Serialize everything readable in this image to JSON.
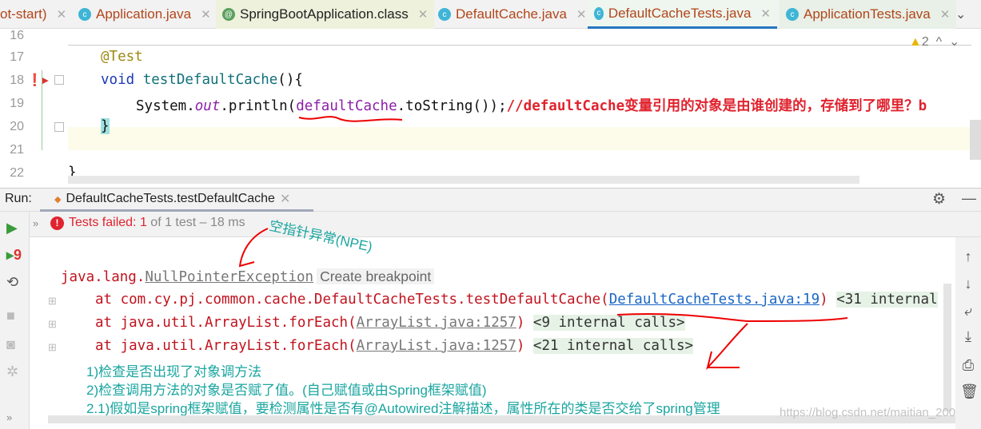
{
  "tabs": [
    {
      "label": "ot-start)",
      "icon": "none"
    },
    {
      "label": "Application.java",
      "icon": "spring-class-icon"
    },
    {
      "label": "SpringBootApplication.class",
      "icon": "annotation-icon"
    },
    {
      "label": "DefaultCache.java",
      "icon": "class-icon"
    },
    {
      "label": "DefaultCacheTests.java",
      "icon": "test-class-icon",
      "active": true
    },
    {
      "label": "ApplicationTests.java",
      "icon": "test-class-icon"
    }
  ],
  "editor": {
    "line_numbers": [
      "16",
      "17",
      "18",
      "19",
      "20",
      "21",
      "22"
    ],
    "warnings_count": "2",
    "annotation": "@Test",
    "kw_void": "void",
    "method_name": "testDefaultCache",
    "method_tail": "(){",
    "l19_a": "System.",
    "l19_out": "out",
    "l19_b": ".println(",
    "l19_field": "defaultCache",
    "l19_c": ".toString());",
    "l19_comment": "//defaultCache变量引用的对象是由谁创建的，存储到了哪里？b",
    "l20": "}",
    "l22": "}"
  },
  "run": {
    "label": "Run:",
    "tab": "DefaultCacheTests.testDefaultCache",
    "status_prefix": "Tests failed: ",
    "status_failed": "1",
    "status_rest": " of 1 test – 18 ms",
    "retry_count": "9"
  },
  "console": {
    "exc_pkg": "java.lang.",
    "exc_name": "NullPointerException",
    "create_breakpoint": "Create breakpoint",
    "frames": [
      {
        "prefix": "at com.cy.pj.common.cache.DefaultCacheTests.testDefaultCache(",
        "link": "DefaultCacheTests.java:19",
        "suffix": ")",
        "internal": "<31 internal"
      },
      {
        "prefix": "at java.util.ArrayList.forEach(",
        "link": "ArrayList.java:1257",
        "suffix": ")",
        "internal": "<9 internal calls>"
      },
      {
        "prefix": "at java.util.ArrayList.forEach(",
        "link": "ArrayList.java:1257",
        "suffix": ")",
        "internal": "<21 internal calls>"
      }
    ],
    "notes": [
      "1)检查是否出现了对象调方法",
      "2)检查调用方法的对象是否赋了值。(自己赋值或由Spring框架赋值)",
      "2.1)假如是spring框架赋值，要检测属性是否有@Autowired注解描述，属性所在的类是否交给了spring管理"
    ],
    "npe_annotation": "空指针异常(NPE)"
  },
  "watermark": "https://blog.csdn.net/maitian_2008",
  "colors": {
    "error": "#e0232e",
    "note": "#1aa5a0",
    "link": "#1a66c5",
    "active_tab": "#2675bf"
  }
}
